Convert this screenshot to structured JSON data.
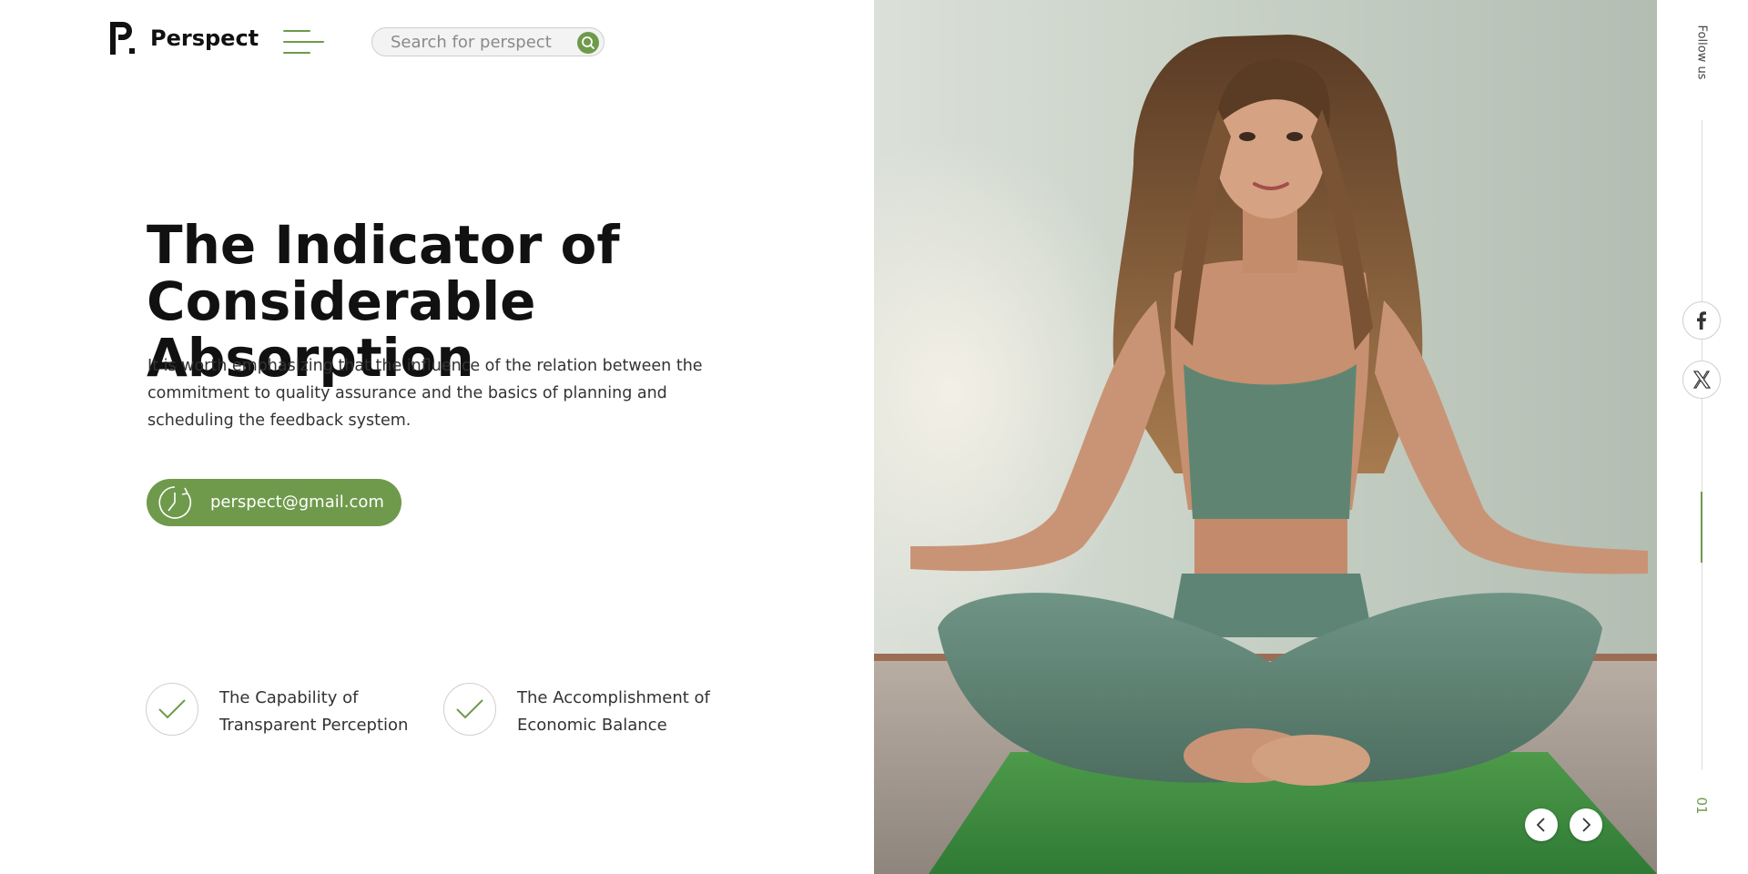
{
  "brand": {
    "name": "Perspect",
    "accent": "#6f9a4c"
  },
  "header": {
    "menu_icon": "hamburger-menu-icon",
    "search": {
      "placeholder": "Search for perspect",
      "value": "",
      "icon": "search-icon"
    }
  },
  "hero": {
    "title_line1": "The Indicator of",
    "title_line2": "Considerable Absorption",
    "description": "It is worth emphasizing that the influence of the relation between the commitment to quality assurance and the basics of planning and scheduling the feedback system.",
    "email_button": {
      "label": "perspect@gmail.com",
      "icon": "clock-icon"
    }
  },
  "features": [
    {
      "line1": "The Capability of",
      "line2": "Transparent Perception",
      "icon": "checkmark-icon"
    },
    {
      "line1": "The Accomplishment of",
      "line2": "Economic Balance",
      "icon": "checkmark-icon"
    }
  ],
  "slider": {
    "prev_icon": "chevron-left-icon",
    "next_icon": "chevron-right-icon",
    "current": "01"
  },
  "social": {
    "label": "Follow us",
    "items": [
      {
        "name": "facebook",
        "icon": "facebook-icon"
      },
      {
        "name": "x",
        "icon": "x-twitter-icon"
      }
    ]
  },
  "image": {
    "subject": "woman-meditating-on-green-yoga-mat"
  }
}
